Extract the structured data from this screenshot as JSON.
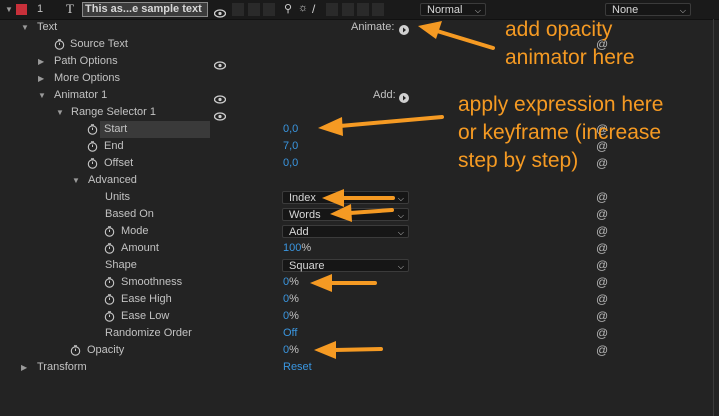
{
  "topbar": {
    "layer_number": "1",
    "layer_type_glyph": "T",
    "layer_name": "This as...e sample text",
    "blend_mode": "Normal",
    "track_matte": "None",
    "label_color": "#c8303a"
  },
  "rows": {
    "text": "Text",
    "animate_label": "Animate:",
    "source_text": "Source Text",
    "path_options": "Path Options",
    "more_options": "More Options",
    "animator": "Animator 1",
    "add_label": "Add:",
    "range_selector": "Range Selector 1",
    "start": "Start",
    "start_value": "0,0",
    "end": "End",
    "end_value": "7,0",
    "offset": "Offset",
    "offset_value": "0,0",
    "advanced": "Advanced",
    "units": "Units",
    "units_value": "Index",
    "based_on": "Based On",
    "based_on_value": "Words",
    "mode": "Mode",
    "mode_value": "Add",
    "amount": "Amount",
    "amount_value": "100",
    "shape": "Shape",
    "shape_value": "Square",
    "smoothness": "Smoothness",
    "smoothness_value": "0",
    "ease_high": "Ease High",
    "ease_high_value": "0",
    "ease_low": "Ease Low",
    "ease_low_value": "0",
    "randomize_order": "Randomize Order",
    "randomize_value": "Off",
    "opacity": "Opacity",
    "opacity_value": "0",
    "transform": "Transform",
    "transform_value": "Reset",
    "percent": "%"
  },
  "annotations": {
    "opacity_note_1": "add opacity",
    "opacity_note_2": "animator here",
    "expr_note_1": "apply expression here",
    "expr_note_2": "or keyframe (increase",
    "expr_note_3": "step by step)",
    "color": "#f59a23"
  }
}
